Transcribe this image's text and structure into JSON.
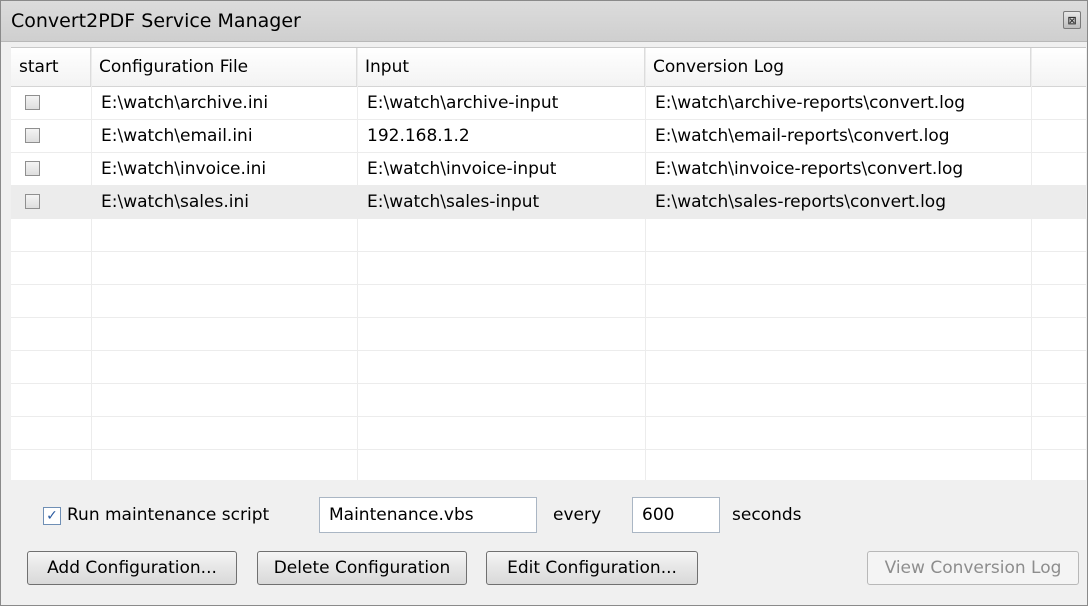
{
  "window": {
    "title": "Convert2PDF Service Manager",
    "close_glyph": "⊠"
  },
  "table": {
    "columns": [
      "start",
      "Configuration File",
      "Input",
      "Conversion Log"
    ],
    "rows": [
      {
        "start": false,
        "config": "E:\\watch\\archive.ini",
        "input": "E:\\watch\\archive-input",
        "log": "E:\\watch\\archive-reports\\convert.log",
        "selected": false
      },
      {
        "start": false,
        "config": "E:\\watch\\email.ini",
        "input": "192.168.1.2",
        "log": "E:\\watch\\email-reports\\convert.log",
        "selected": false
      },
      {
        "start": false,
        "config": "E:\\watch\\invoice.ini",
        "input": "E:\\watch\\invoice-input",
        "log": "E:\\watch\\invoice-reports\\convert.log",
        "selected": false
      },
      {
        "start": false,
        "config": "E:\\watch\\sales.ini",
        "input": "E:\\watch\\sales-input",
        "log": "E:\\watch\\sales-reports\\convert.log",
        "selected": true
      }
    ]
  },
  "maintenance": {
    "checked": true,
    "check_glyph": "✓",
    "label": "Run maintenance script",
    "script": "Maintenance.vbs",
    "every_label": "every",
    "interval": "600",
    "seconds_label": "seconds"
  },
  "buttons": {
    "add": "Add Configuration...",
    "delete": "Delete Configuration",
    "edit": "Edit Configuration...",
    "view_log": "View Conversion Log"
  }
}
